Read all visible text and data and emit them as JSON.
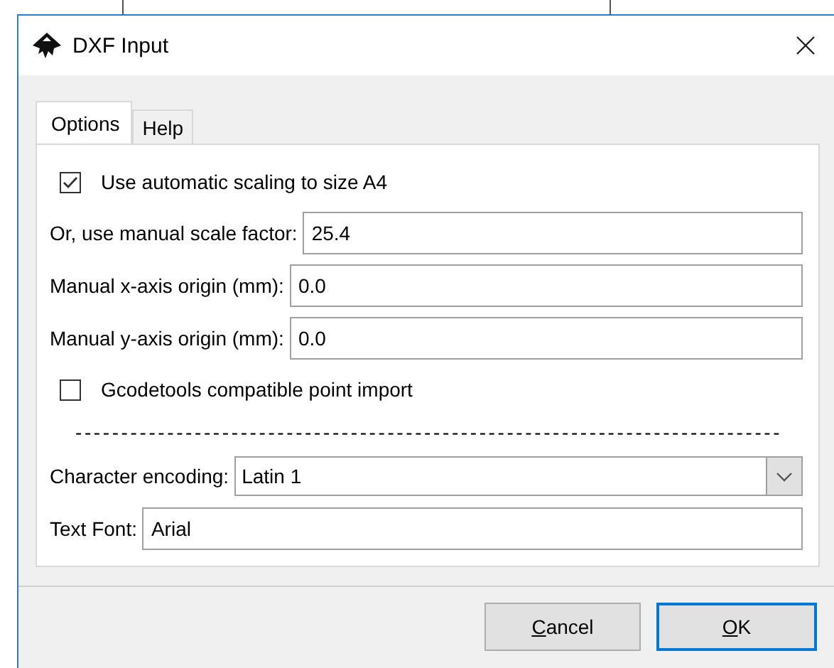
{
  "window": {
    "title": "DXF Input"
  },
  "tabs": [
    {
      "label": "Options",
      "selected": true
    },
    {
      "label": "Help",
      "selected": false
    }
  ],
  "options": [
    {
      "kind": "checkbox",
      "label": "Use automatic scaling to size A4",
      "checked": true
    },
    {
      "kind": "field",
      "label": "Or, use manual scale factor:",
      "value": "25.4"
    },
    {
      "kind": "field",
      "label": "Manual x-axis origin (mm):",
      "value": "0.0"
    },
    {
      "kind": "field",
      "label": "Manual y-axis origin (mm):",
      "value": "0.0"
    },
    {
      "kind": "checkbox",
      "label": "Gcodetools compatible point import",
      "checked": false
    },
    {
      "kind": "separator",
      "label": "-----------------------------------------------------------------------------"
    },
    {
      "kind": "dropdown",
      "label": "Character encoding:",
      "value": "Latin 1"
    },
    {
      "kind": "field",
      "label": "Text Font:",
      "value": "Arial"
    }
  ],
  "buttons": [
    {
      "label": "Cancel",
      "default": false,
      "mnemonic_underlined": true
    },
    {
      "label": "OK",
      "default": true,
      "mnemonic_underlined": true
    }
  ]
}
